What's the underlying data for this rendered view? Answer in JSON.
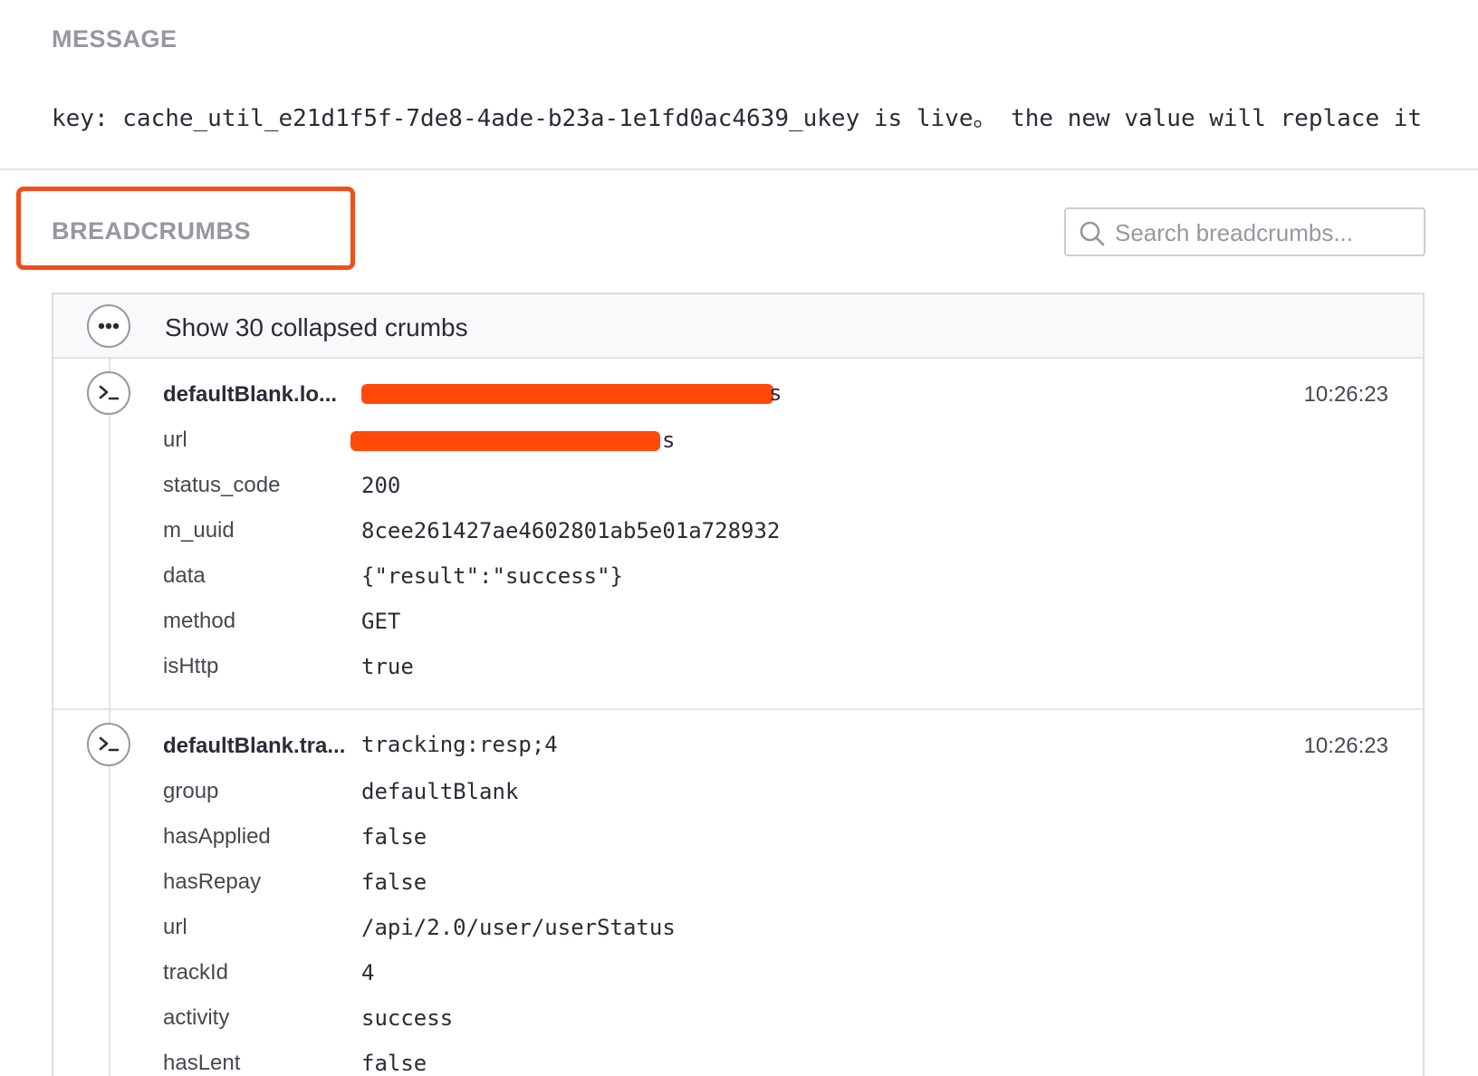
{
  "message": {
    "heading": "MESSAGE",
    "text": "key: cache_util_e21d1f5f-7de8-4ade-b23a-1e1fd0ac4639_ukey is live。 the new value will replace it"
  },
  "breadcrumbs": {
    "heading": "BREADCRUMBS",
    "highlight_color": "#f24d1c",
    "search": {
      "placeholder": "Search breadcrumbs...",
      "value": ""
    },
    "collapsed": {
      "label": "Show 30 collapsed crumbs",
      "icon": "ellipsis-icon"
    },
    "crumbs": [
      {
        "icon": "terminal-icon",
        "title": "defaultBlank.lo...",
        "main_value_tail": "s",
        "time": "10:26:23",
        "fields": [
          {
            "key": "url",
            "value": "s",
            "redacted": true
          },
          {
            "key": "status_code",
            "value": "200"
          },
          {
            "key": "m_uuid",
            "value": "8cee261427ae4602801ab5e01a728932"
          },
          {
            "key": "data",
            "value": "{\"result\":\"success\"}"
          },
          {
            "key": "method",
            "value": "GET"
          },
          {
            "key": "isHttp",
            "value": "true"
          }
        ]
      },
      {
        "icon": "terminal-icon",
        "title": "defaultBlank.tra...",
        "main_value": "tracking:resp;4",
        "time": "10:26:23",
        "fields": [
          {
            "key": "group",
            "value": "defaultBlank"
          },
          {
            "key": "hasApplied",
            "value": "false"
          },
          {
            "key": "hasRepay",
            "value": "false"
          },
          {
            "key": "url",
            "value": "/api/2.0/user/userStatus"
          },
          {
            "key": "trackId",
            "value": "4"
          },
          {
            "key": "activity",
            "value": "success"
          },
          {
            "key": "hasLent",
            "value": "false"
          }
        ]
      }
    ]
  }
}
